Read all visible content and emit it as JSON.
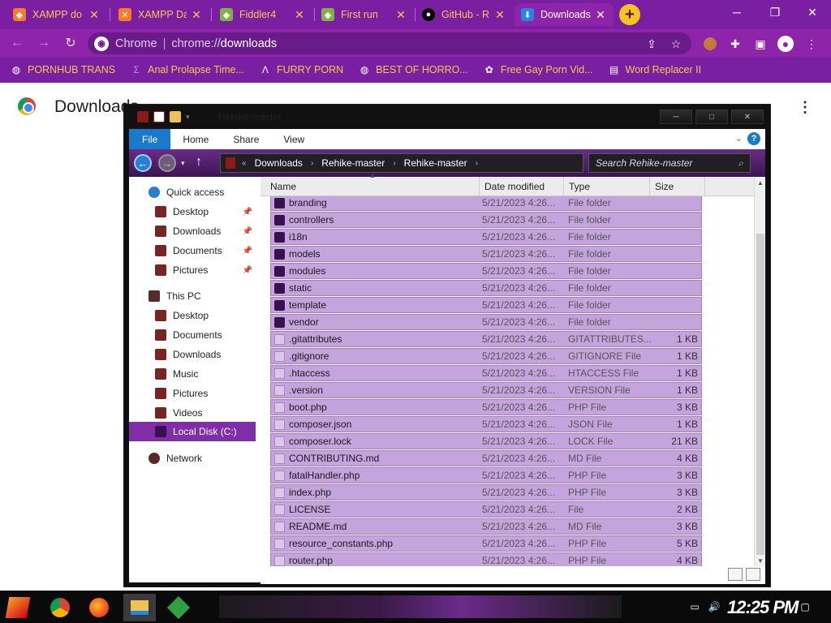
{
  "browser": {
    "tabs": [
      {
        "title": "XAMPP do",
        "icon": "xampp-icon"
      },
      {
        "title": "XAMPP Da",
        "icon": "xampp-icon"
      },
      {
        "title": "Fiddler4",
        "icon": "fiddler-icon"
      },
      {
        "title": "First run",
        "icon": "fiddler-icon"
      },
      {
        "title": "GitHub - R",
        "icon": "github-icon"
      },
      {
        "title": "Downloads",
        "icon": "download-icon",
        "active": true
      }
    ],
    "omnibox": {
      "scheme_label": "Chrome",
      "url_scheme": "chrome://",
      "url_host": "downloads"
    },
    "bookmarks": [
      {
        "label": "PORNHUB TRANS",
        "icon": "globe-icon"
      },
      {
        "label": "Anal Prolapse Time...",
        "icon": "bookmark-icon"
      },
      {
        "label": "FURRY PORN",
        "icon": "lambda-icon"
      },
      {
        "label": "BEST OF HORRO...",
        "icon": "globe-icon"
      },
      {
        "label": "Free Gay Porn Vid...",
        "icon": "site-icon"
      },
      {
        "label": "Word Replacer II",
        "icon": "extension-icon"
      }
    ],
    "page_title": "Downloads"
  },
  "explorer": {
    "title": "Rehike-master",
    "ribbon_tabs": [
      "File",
      "Home",
      "Share",
      "View"
    ],
    "breadcrumb": [
      "Downloads",
      "Rehike-master",
      "Rehike-master"
    ],
    "search_placeholder": "Search Rehike-master",
    "nav": [
      {
        "label": "Quick access",
        "level": 0,
        "kind": "star"
      },
      {
        "label": "Desktop",
        "level": 1,
        "pinned": true
      },
      {
        "label": "Downloads",
        "level": 1,
        "pinned": true
      },
      {
        "label": "Documents",
        "level": 1,
        "pinned": true
      },
      {
        "label": "Pictures",
        "level": 1,
        "pinned": true
      },
      {
        "label": "This PC",
        "level": 0,
        "kind": "pc"
      },
      {
        "label": "Desktop",
        "level": 1
      },
      {
        "label": "Documents",
        "level": 1
      },
      {
        "label": "Downloads",
        "level": 1
      },
      {
        "label": "Music",
        "level": 1
      },
      {
        "label": "Pictures",
        "level": 1
      },
      {
        "label": "Videos",
        "level": 1
      },
      {
        "label": "Local Disk (C:)",
        "level": 1,
        "selected": true
      },
      {
        "label": "Network",
        "level": 0,
        "kind": "net"
      }
    ],
    "columns": [
      "Name",
      "Date modified",
      "Type",
      "Size"
    ],
    "files": [
      {
        "name": "branding",
        "date": "5/21/2023 4:26...",
        "type": "File folder",
        "size": "",
        "folder": true
      },
      {
        "name": "controllers",
        "date": "5/21/2023 4:26...",
        "type": "File folder",
        "size": "",
        "folder": true
      },
      {
        "name": "i18n",
        "date": "5/21/2023 4:26...",
        "type": "File folder",
        "size": "",
        "folder": true
      },
      {
        "name": "models",
        "date": "5/21/2023 4:26...",
        "type": "File folder",
        "size": "",
        "folder": true
      },
      {
        "name": "modules",
        "date": "5/21/2023 4:26...",
        "type": "File folder",
        "size": "",
        "folder": true
      },
      {
        "name": "static",
        "date": "5/21/2023 4:26...",
        "type": "File folder",
        "size": "",
        "folder": true
      },
      {
        "name": "template",
        "date": "5/21/2023 4:26...",
        "type": "File folder",
        "size": "",
        "folder": true
      },
      {
        "name": "vendor",
        "date": "5/21/2023 4:26...",
        "type": "File folder",
        "size": "",
        "folder": true
      },
      {
        "name": ".gitattributes",
        "date": "5/21/2023 4:26...",
        "type": "GITATTRIBUTES...",
        "size": "1 KB"
      },
      {
        "name": ".gitignore",
        "date": "5/21/2023 4:26...",
        "type": "GITIGNORE File",
        "size": "1 KB"
      },
      {
        "name": ".htaccess",
        "date": "5/21/2023 4:26...",
        "type": "HTACCESS File",
        "size": "1 KB"
      },
      {
        "name": ".version",
        "date": "5/21/2023 4:26...",
        "type": "VERSION File",
        "size": "1 KB"
      },
      {
        "name": "boot.php",
        "date": "5/21/2023 4:26...",
        "type": "PHP File",
        "size": "3 KB"
      },
      {
        "name": "composer.json",
        "date": "5/21/2023 4:26...",
        "type": "JSON File",
        "size": "1 KB"
      },
      {
        "name": "composer.lock",
        "date": "5/21/2023 4:26...",
        "type": "LOCK File",
        "size": "21 KB"
      },
      {
        "name": "CONTRIBUTING.md",
        "date": "5/21/2023 4:26...",
        "type": "MD File",
        "size": "4 KB"
      },
      {
        "name": "fatalHandler.php",
        "date": "5/21/2023 4:26...",
        "type": "PHP File",
        "size": "3 KB"
      },
      {
        "name": "index.php",
        "date": "5/21/2023 4:26...",
        "type": "PHP File",
        "size": "3 KB"
      },
      {
        "name": "LICENSE",
        "date": "5/21/2023 4:26...",
        "type": "File",
        "size": "2 KB"
      },
      {
        "name": "README.md",
        "date": "5/21/2023 4:26...",
        "type": "MD File",
        "size": "3 KB"
      },
      {
        "name": "resource_constants.php",
        "date": "5/21/2023 4:26...",
        "type": "PHP File",
        "size": "5 KB"
      },
      {
        "name": "router.php",
        "date": "5/21/2023 4:26...",
        "type": "PHP File",
        "size": "4 KB"
      }
    ]
  },
  "taskbar": {
    "apps": [
      "start-icon",
      "chrome-icon",
      "firefox-icon",
      "file-explorer-icon",
      "app-icon"
    ],
    "clock": "12:25 PM"
  },
  "colors": {
    "accent": "#8e24aa",
    "tab_text": "#f7c948",
    "selection": "#c5a3dd"
  }
}
